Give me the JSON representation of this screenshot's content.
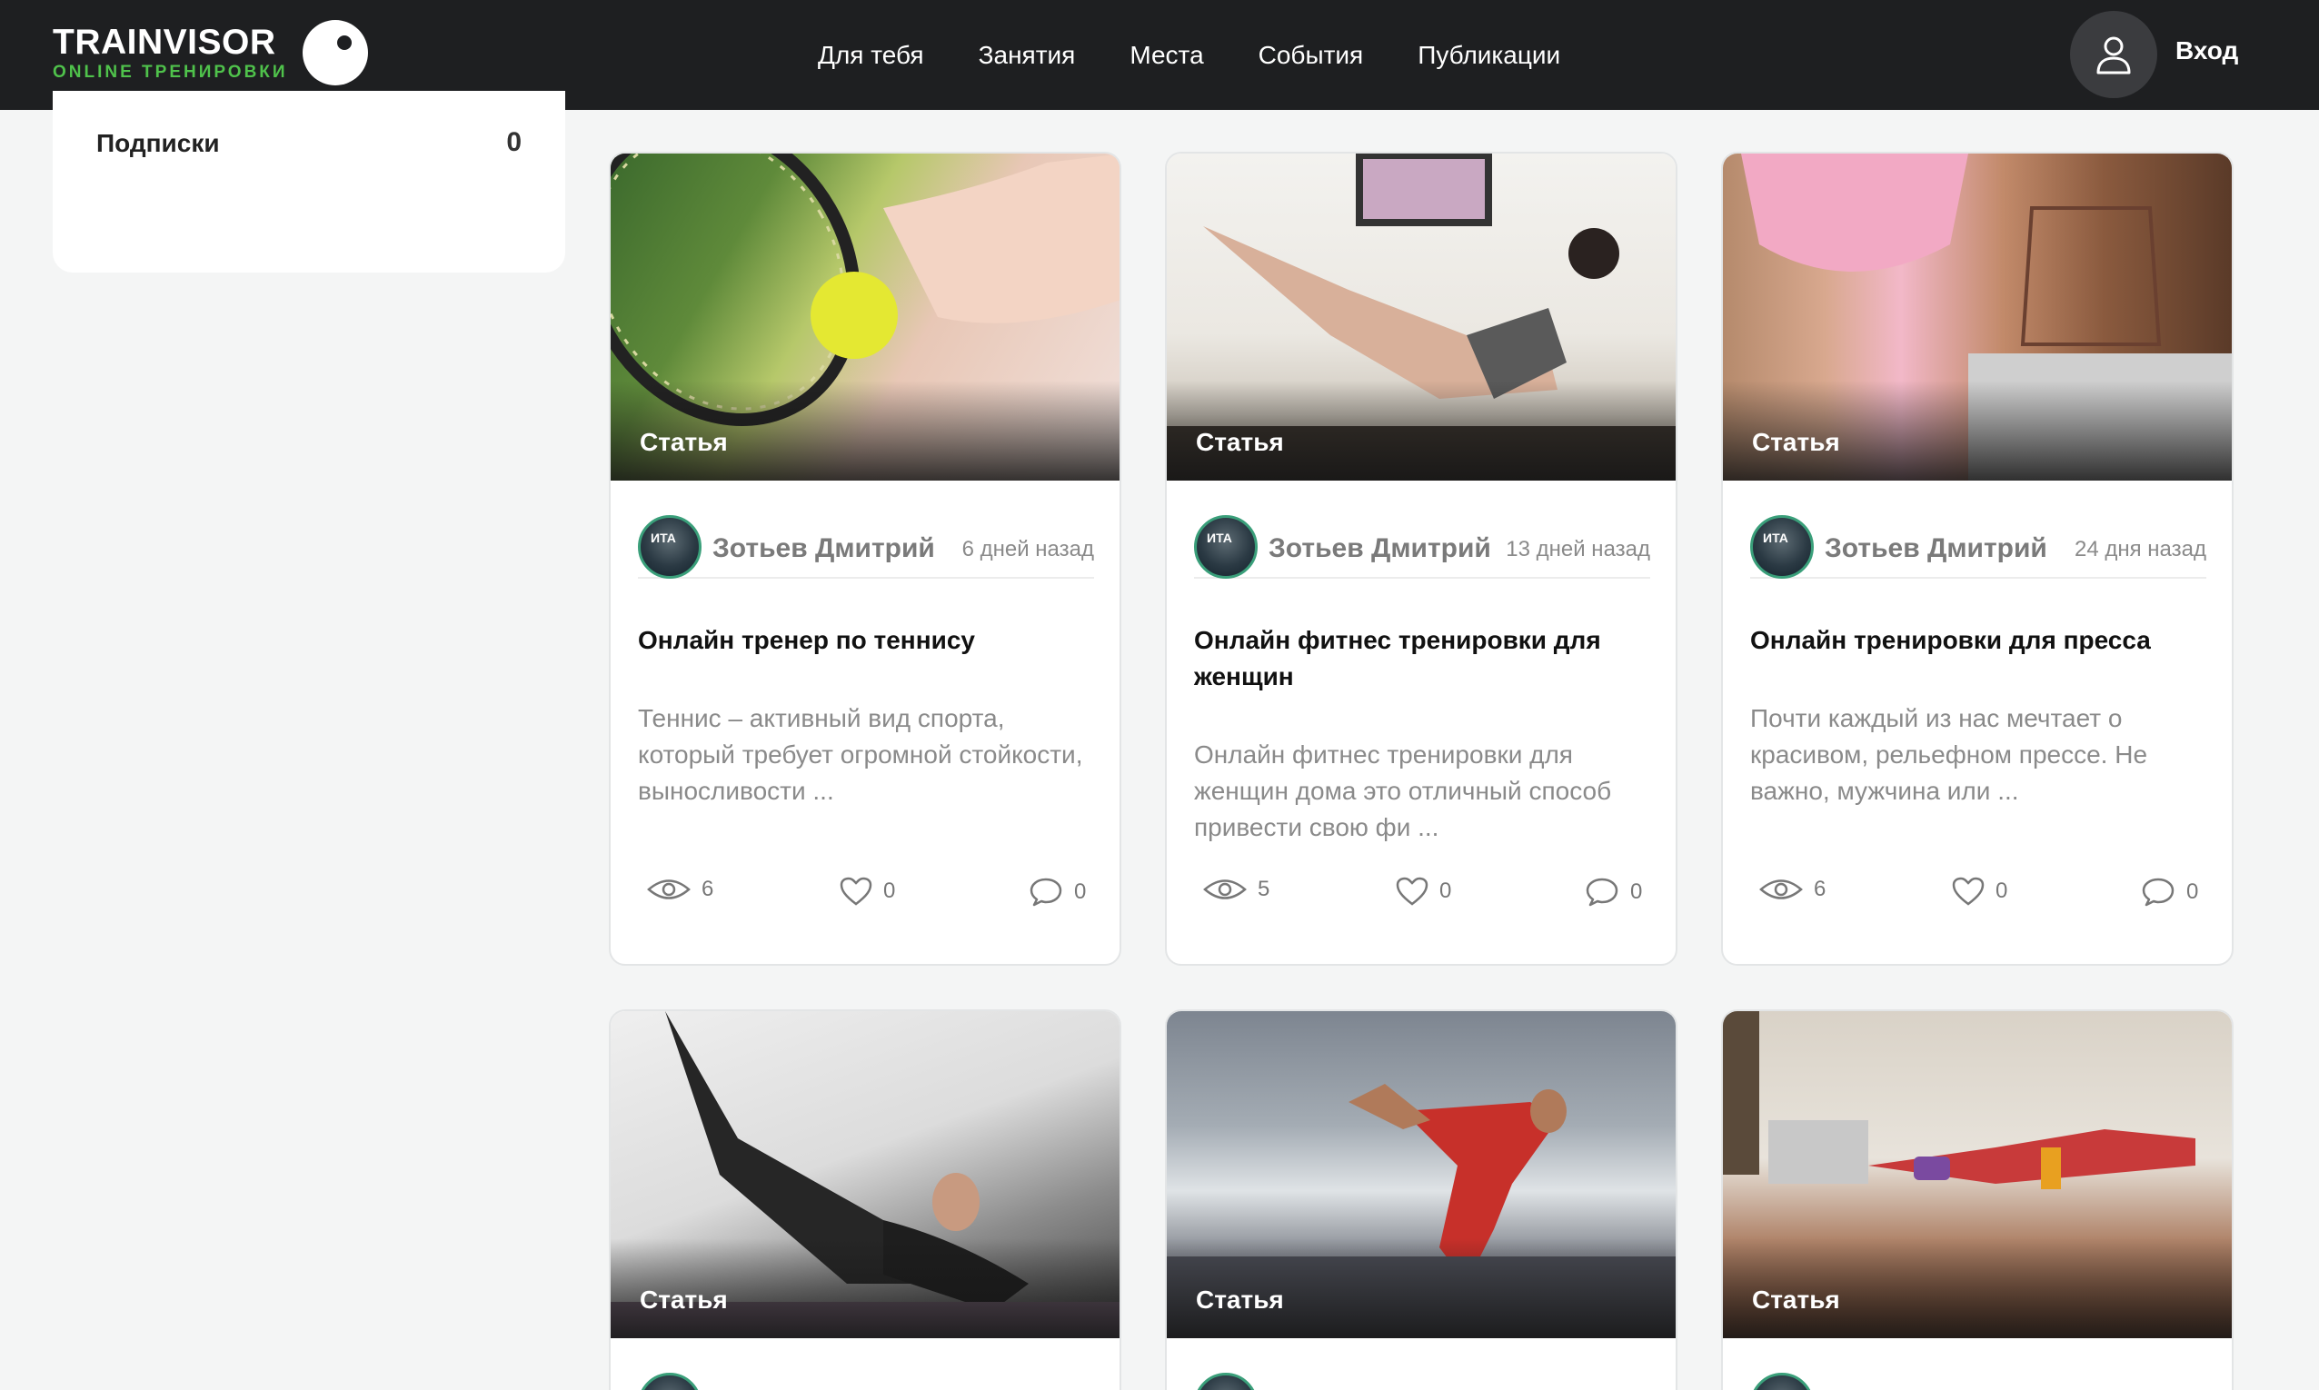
{
  "header": {
    "logo_main": "TRAINVISOR",
    "logo_sub": "ONLINE ТРЕНИРОВКИ",
    "nav": [
      "Для тебя",
      "Занятия",
      "Места",
      "События",
      "Публикации"
    ],
    "login_label": "Вход"
  },
  "sidebar": {
    "subscriptions_label": "Подписки",
    "subscriptions_count": "0"
  },
  "cards": [
    {
      "tag": "Статья",
      "author": "Зотьев Дмитрий",
      "date": "6 дней назад",
      "title": "Онлайн тренер по теннису",
      "text": "  Теннис – активный вид спорта, который требует огромной стойкости, выносливости ...",
      "views": "6",
      "likes": "0",
      "comments": "0"
    },
    {
      "tag": "Статья",
      "author": "Зотьев Дмитрий",
      "date": "13 дней назад",
      "title": "Онлайн фитнес тренировки для женщин",
      "text": "  Онлайн фитнес тренировки для женщин дома это отличный способ привести свою фи ...",
      "views": "5",
      "likes": "0",
      "comments": "0"
    },
    {
      "tag": "Статья",
      "author": "Зотьев Дмитрий",
      "date": "24 дня назад",
      "title": "Онлайн тренировки для пресса",
      "text": "Почти каждый из нас мечтает о красивом, рельефном прессе.  Не важно, мужчина или ...",
      "views": "6",
      "likes": "0",
      "comments": "0"
    },
    {
      "tag": "Статья"
    },
    {
      "tag": "Статья"
    },
    {
      "tag": "Статья"
    }
  ],
  "colors": {
    "header_bg": "#1e1f21",
    "brand_green": "#4fc24b",
    "page_bg": "#f4f5f5"
  },
  "icons": [
    "user-icon",
    "eye-icon",
    "heart-icon",
    "comment-icon"
  ]
}
